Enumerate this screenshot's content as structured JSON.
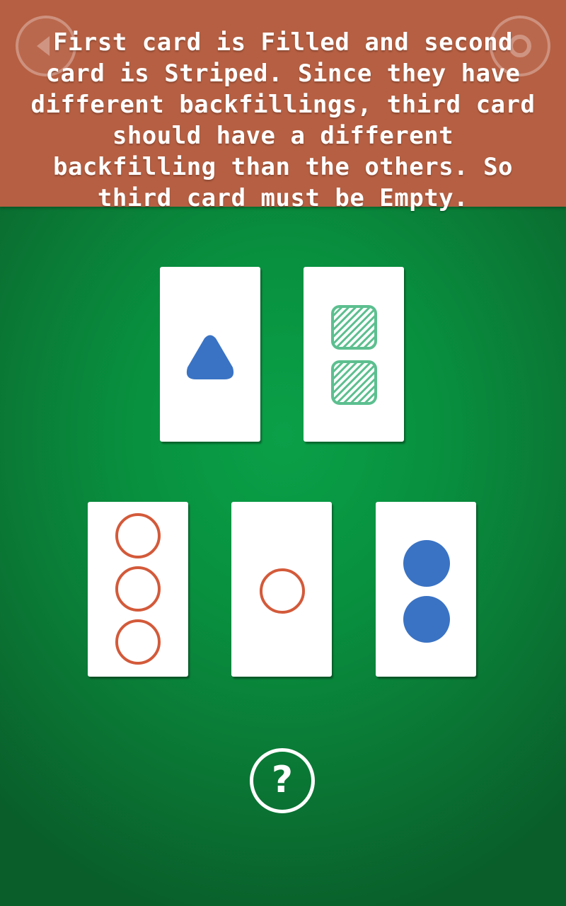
{
  "hint": {
    "text": "First card is Filled and second card is Striped. Since they have different backfillings, third card should have a different backfilling than the others. So third card must be Empty."
  },
  "top_bar": {
    "back_icon": "back-arrow-icon",
    "settings_icon": "gear-icon"
  },
  "colors": {
    "banner": "#b65f42",
    "table": "#0a8a3f",
    "blue": "#3a73c4",
    "green": "#5cbf8f",
    "red": "#d35a3a"
  },
  "puzzle_cards": [
    {
      "count": 1,
      "shape": "triangle",
      "fill": "filled",
      "color": "blue"
    },
    {
      "count": 2,
      "shape": "square",
      "fill": "striped",
      "color": "green"
    }
  ],
  "answer_cards": [
    {
      "count": 3,
      "shape": "circle",
      "fill": "empty",
      "color": "red"
    },
    {
      "count": 1,
      "shape": "circle",
      "fill": "empty",
      "color": "red"
    },
    {
      "count": 2,
      "shape": "circle",
      "fill": "filled",
      "color": "blue"
    }
  ],
  "help_button": {
    "label": "?"
  }
}
